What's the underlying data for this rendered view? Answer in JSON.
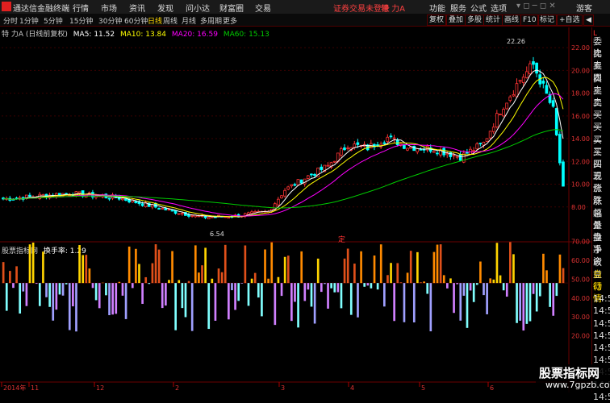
{
  "app": {
    "title": "通达信金融终端"
  },
  "menu": [
    "行情",
    "市场",
    "资讯",
    "发现",
    "问小达",
    "财富圈",
    "交易"
  ],
  "status_alert": "证券交易未登录",
  "stock_tab": "特 力A",
  "right_menu": [
    "功能",
    "服务",
    "公式",
    "选项"
  ],
  "guest": "游客",
  "periods": [
    "分时",
    "1分钟",
    "5分钟",
    "15分钟",
    "30分钟",
    "60分钟",
    "日线",
    "周线",
    "月线",
    "多周期",
    "更多"
  ],
  "right_buttons": [
    "复权",
    "叠加",
    "多股",
    "统计",
    "画线",
    "F10",
    "标记",
    "+自选",
    "◀"
  ],
  "ma_info": {
    "label": "特 力A (日线前复权)",
    "ma5": "MA5: 11.52",
    "ma10": "MA10: 13.84",
    "ma20": "MA20: 16.59",
    "ma60": "MA60: 15.13"
  },
  "price_labels": {
    "high": "22.26",
    "low": "6.54",
    "marker": "定"
  },
  "sub_info": {
    "label": "股票指标网",
    "value": "换手率: 1.29"
  },
  "right_panel": [
    "委比",
    "卖五",
    "卖四",
    "卖三",
    "卖二",
    "卖一",
    "买一",
    "买二",
    "买三",
    "买四",
    "买五",
    "现价",
    "涨跌",
    "涨幅",
    "总量",
    "外盘",
    "换手",
    "净资",
    "收益",
    "自动",
    "行情",
    "14:56",
    "14:56",
    "14:56",
    "14:56",
    "14:56",
    "14:56",
    "14:56",
    "14:56",
    "14:56"
  ],
  "right_panel_top": "L",
  "watermark": {
    "line1": "股票指标网",
    "line2": "www.7gpzb.com"
  },
  "chart_data": [
    {
      "type": "candlestick",
      "ylim": [
        6,
        23
      ],
      "y_ticks": [
        "22.00",
        "20.00",
        "18.00",
        "16.00",
        "14.00",
        "12.00",
        "10.00",
        "8.00"
      ],
      "x_ticks": [
        "2014年",
        "11",
        "12",
        "2",
        "3",
        "4",
        "5",
        "6"
      ],
      "high": 22.26,
      "low": 6.54,
      "colors": {
        "up": "#ff3333",
        "down": "#00ffff",
        "ma5": "#ffffff",
        "ma10": "#ffff00",
        "ma20": "#ff00ff",
        "ma60": "#00cc00"
      }
    },
    {
      "type": "bar",
      "ylim": [
        10,
        75
      ],
      "y_ticks": [
        "70.00",
        "60.00",
        "50.00",
        "40.00",
        "30.00",
        "20.00"
      ],
      "baseline": 48,
      "colors": {
        "up": [
          "#ffd400",
          "#ff8a00",
          "#e0501a"
        ],
        "down": [
          "#80ffff",
          "#a0a0ff",
          "#d080ff"
        ]
      }
    }
  ]
}
